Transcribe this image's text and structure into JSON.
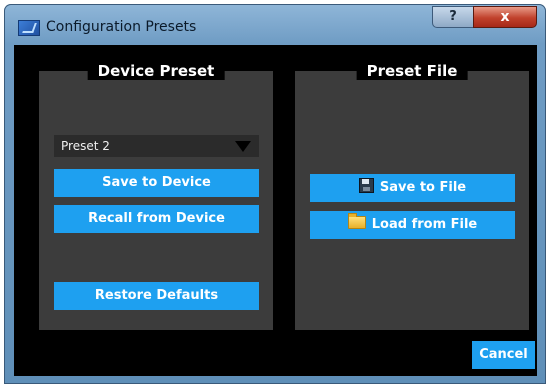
{
  "window": {
    "title": "Configuration Presets",
    "help_label": "?",
    "close_label": "x",
    "app_icon": "app-icon"
  },
  "device_preset": {
    "title": "Device Preset",
    "selected_preset": "Preset 2",
    "save_label": "Save to Device",
    "recall_label": "Recall from Device",
    "restore_label": "Restore Defaults"
  },
  "preset_file": {
    "title": "Preset File",
    "save_label": "Save to File",
    "save_icon": "floppy-disk-icon",
    "load_label": "Load from File",
    "load_icon": "folder-icon"
  },
  "footer": {
    "cancel_label": "Cancel"
  },
  "colors": {
    "accent": "#1ea0f0",
    "panel": "#3c3c3c",
    "background": "#000000"
  }
}
